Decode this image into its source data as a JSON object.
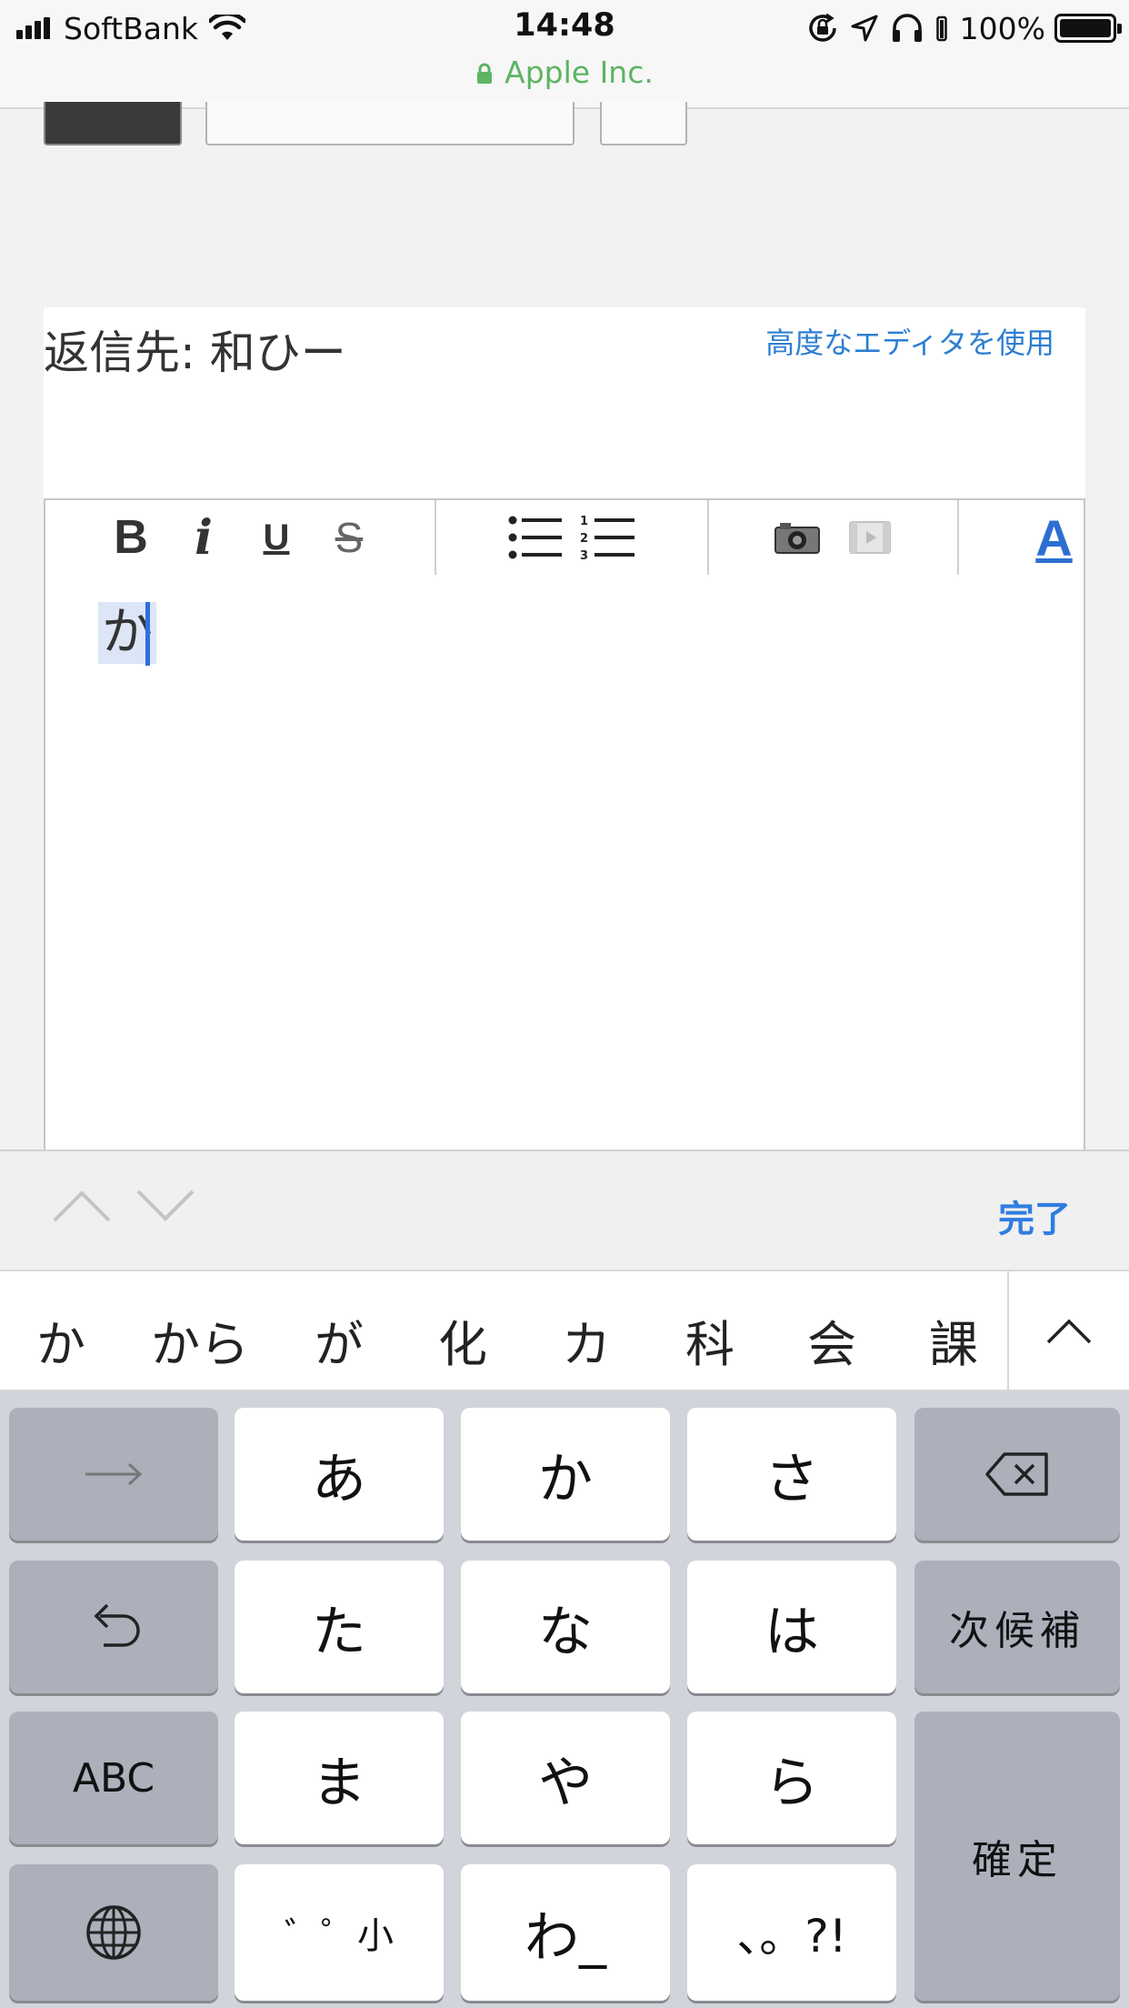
{
  "status_bar": {
    "carrier": "SoftBank",
    "time": "14:48",
    "battery_percent": "100%",
    "site": "Apple Inc."
  },
  "reply": {
    "label": "返信先: 和ひー",
    "advanced_editor_link": "高度なエディタを使用"
  },
  "toolbar": {
    "bold": "B",
    "italic": "i",
    "underline": "U",
    "strike": "S",
    "font_color": "A"
  },
  "editor": {
    "text": "か"
  },
  "accessory": {
    "done": "完了"
  },
  "candidates": [
    "か",
    "から",
    "が",
    "化",
    "カ",
    "科",
    "会",
    "課"
  ],
  "keyboard": {
    "row1": [
      "あ",
      "か",
      "さ"
    ],
    "row2": [
      "た",
      "な",
      "は"
    ],
    "row3": [
      "ま",
      "や",
      "ら"
    ],
    "row4": [
      "゛゜小",
      "わ_",
      "、。?!"
    ],
    "abc": "ABC",
    "next_candidate": "次候補",
    "confirm": "確定"
  },
  "colors": {
    "accent": "#2f7de1",
    "lock_green": "#5db462",
    "keyboard_bg": "#d1d4da"
  }
}
